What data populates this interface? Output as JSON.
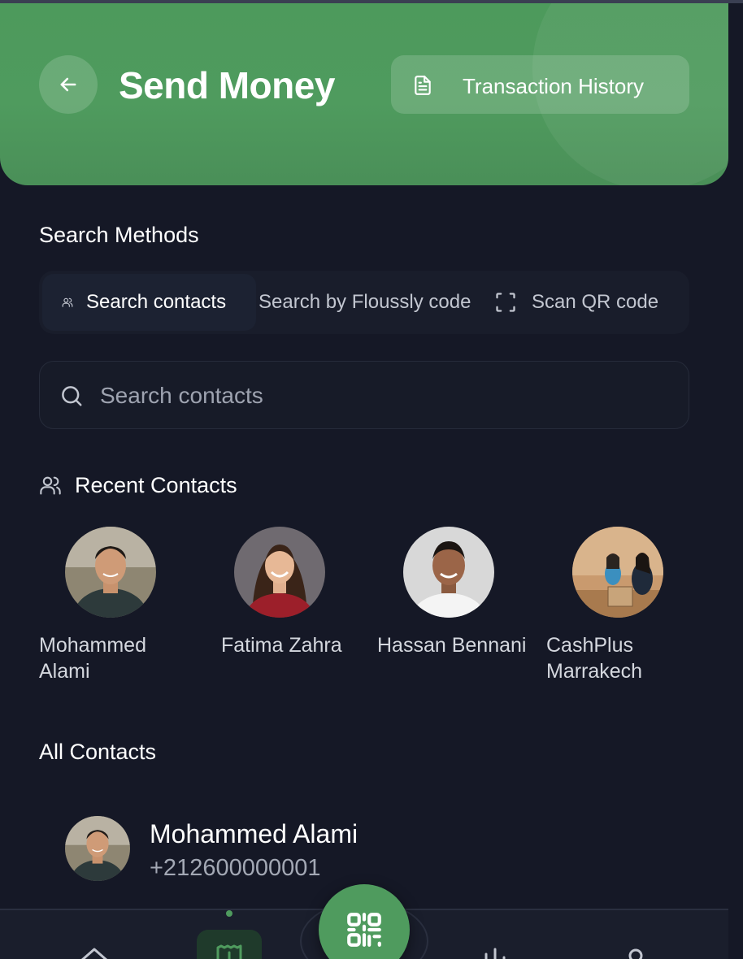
{
  "header": {
    "title": "Send Money",
    "history_label": "Transaction History"
  },
  "search_methods": {
    "title": "Search Methods",
    "options": [
      {
        "label": "Search contacts",
        "active": true
      },
      {
        "label": "Search by Floussly code",
        "active": false
      },
      {
        "label": "Scan QR code",
        "active": false
      }
    ]
  },
  "search": {
    "placeholder": "Search contacts",
    "value": ""
  },
  "recent": {
    "title": "Recent Contacts",
    "contacts": [
      {
        "name": "Mohammed Alami"
      },
      {
        "name": "Fatima Zahra"
      },
      {
        "name": "Hassan Bennani"
      },
      {
        "name": "CashPlus Marrakech"
      }
    ]
  },
  "all_contacts": {
    "title": "All Contacts",
    "items": [
      {
        "name": "Mohammed Alami",
        "phone": "+212600000001"
      }
    ]
  },
  "bottom_nav": {
    "items": [
      "home-icon",
      "transfer-icon",
      "qr-scan-icon",
      "stats-icon",
      "profile-icon"
    ],
    "active_index": 1
  },
  "colors": {
    "accent": "#4f9b5e",
    "background": "#151826",
    "surface": "#191d2b"
  }
}
